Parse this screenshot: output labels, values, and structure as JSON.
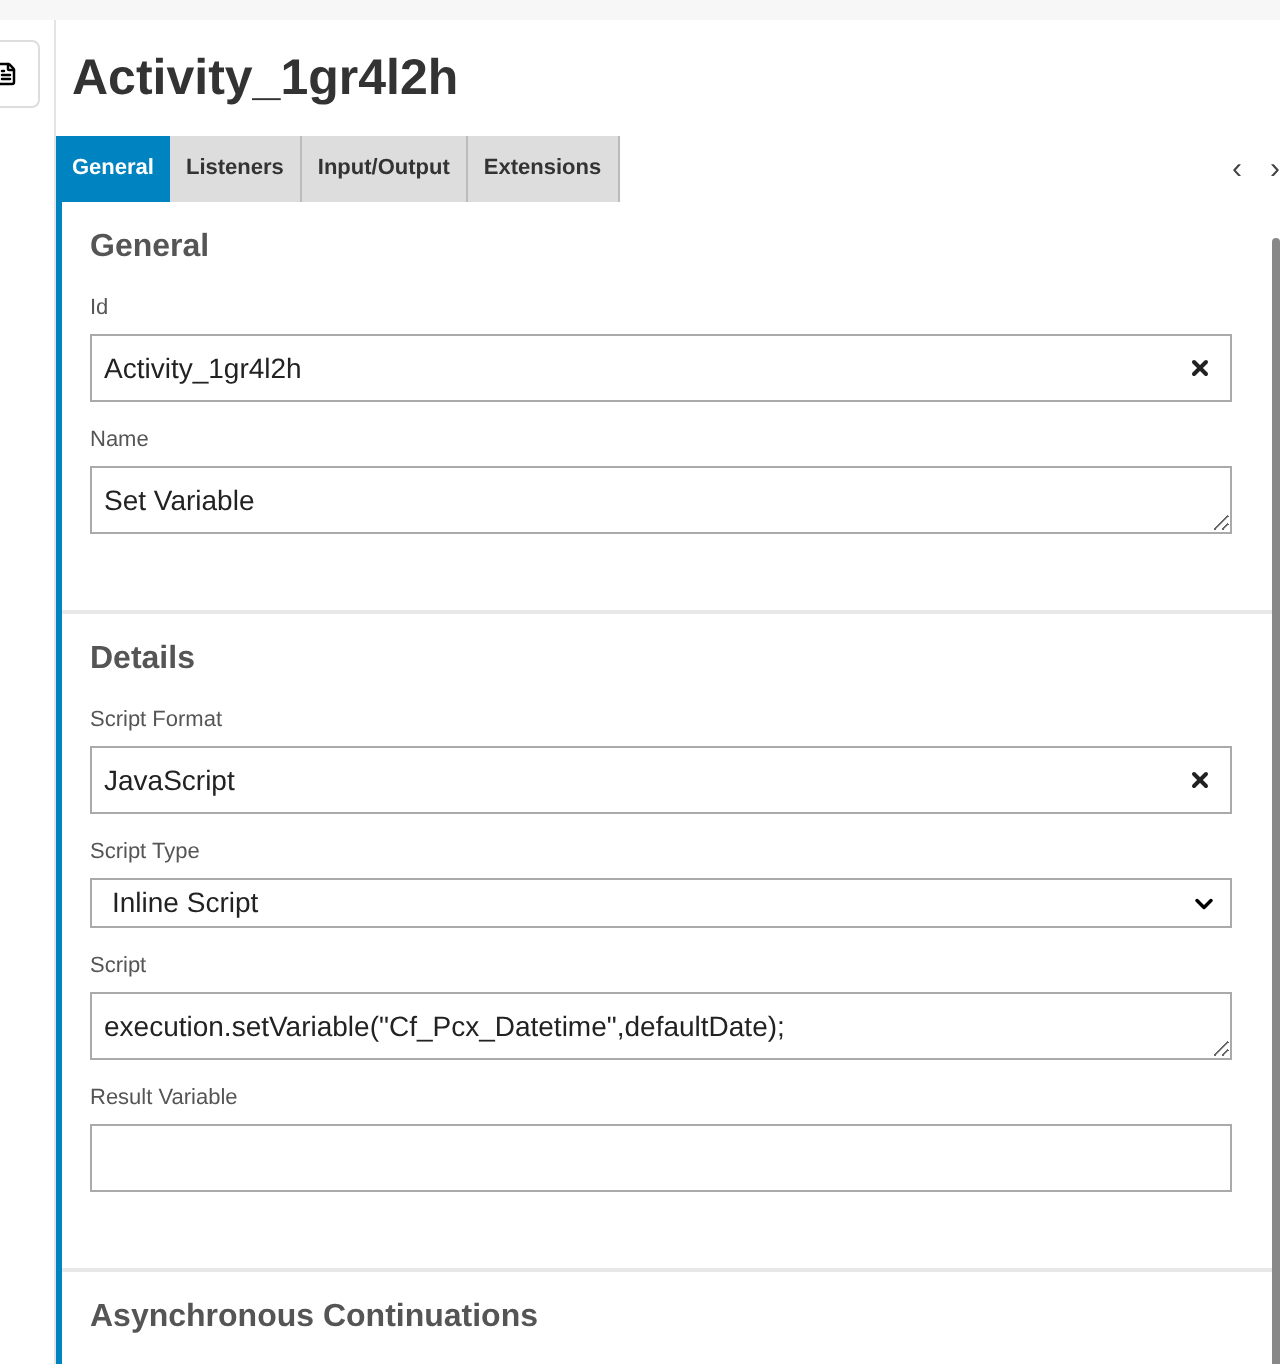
{
  "title": "Activity_1gr4l2h",
  "tabs": [
    {
      "label": "General",
      "selected": true
    },
    {
      "label": "Listeners",
      "selected": false
    },
    {
      "label": "Input/Output",
      "selected": false
    },
    {
      "label": "Extensions",
      "selected": false
    }
  ],
  "tab_nav": [
    "‹",
    "›"
  ],
  "sections": [
    {
      "heading": "General",
      "fields": [
        {
          "label": "Id",
          "kind": "clearable",
          "value": "Activity_1gr4l2h"
        },
        {
          "label": "Name",
          "kind": "textarea",
          "value": "Set Variable"
        }
      ]
    },
    {
      "heading": "Details",
      "fields": [
        {
          "label": "Script Format",
          "kind": "clearable",
          "value": "JavaScript"
        },
        {
          "label": "Script Type",
          "kind": "select",
          "value": "Inline Script"
        },
        {
          "label": "Script",
          "kind": "textarea",
          "value": "execution.setVariable(\"Cf_Pcx_Datetime\",defaultDate);"
        },
        {
          "label": "Result Variable",
          "kind": "text"
        }
      ]
    },
    {
      "heading": "Asynchronous Continuations"
    }
  ]
}
